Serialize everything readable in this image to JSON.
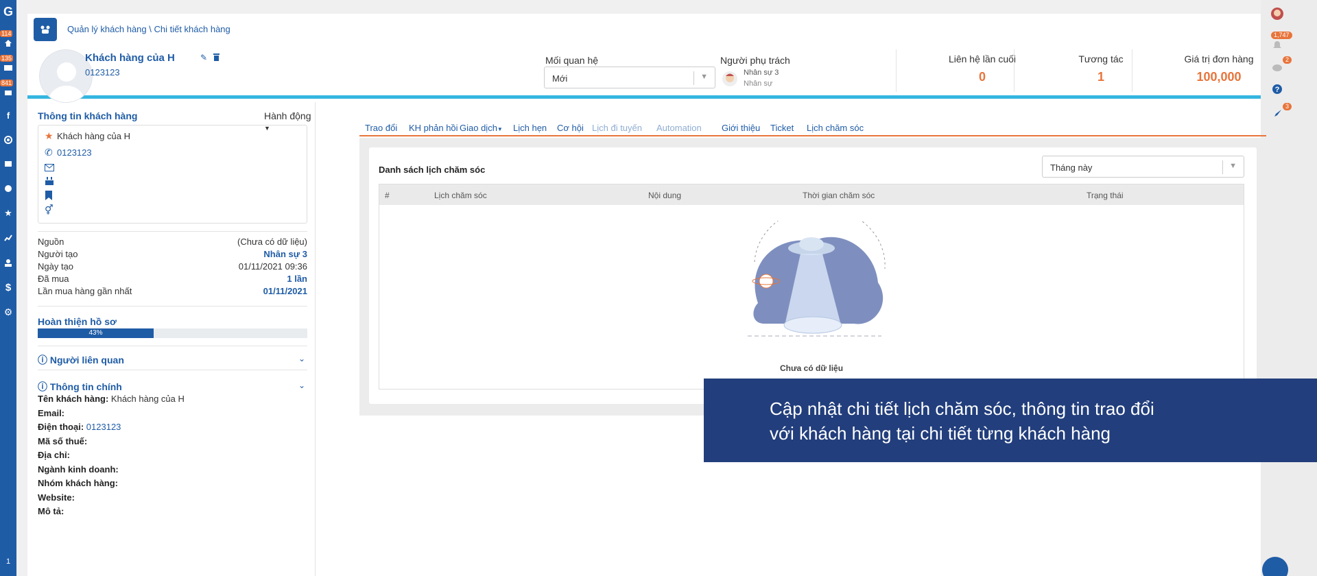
{
  "left_nav": {
    "badges": [
      "114",
      "135",
      "841"
    ],
    "items": [
      "logo-icon",
      "home-icon",
      "mail-icon",
      "cart-icon",
      "facebook-icon",
      "target-icon",
      "shop-icon",
      "coins-icon",
      "star-icon",
      "chart-icon",
      "users-icon",
      "dollar-icon",
      "gear-icon"
    ],
    "bottom_text": "1"
  },
  "right_nav": {
    "badges": [
      "1,747",
      "2",
      "3"
    ],
    "items": [
      "user-avatar-icon",
      "bell-icon",
      "chat-icon",
      "help-icon",
      "rocket-icon"
    ]
  },
  "breadcrumb": "Quản lý khách hàng \\ Chi tiết khách hàng",
  "customer": {
    "name": "Khách hàng của H",
    "phone": "0123123"
  },
  "relationship": {
    "label": "Mối quan hệ",
    "value": "Mới"
  },
  "person_in_charge": {
    "label": "Người phụ trách",
    "name": "Nhân sự 3",
    "role": "Nhân sự"
  },
  "stats": [
    {
      "label": "Liên hệ lần cuối",
      "value": "0"
    },
    {
      "label": "Tương tác",
      "value": "1"
    },
    {
      "label": "Giá trị đơn hàng",
      "value": "100,000"
    }
  ],
  "left_panel": {
    "title": "Thông tin khách hàng",
    "action": "Hành động",
    "infobox": {
      "name": "Khách hàng của H",
      "phone": "0123123"
    },
    "details": [
      {
        "k": "Nguồn",
        "v": "(Chưa có dữ liệu)"
      },
      {
        "k": "Người tạo",
        "v": "Nhân sự 3"
      },
      {
        "k": "Ngày tạo",
        "v": "01/11/2021 09:36"
      },
      {
        "k": "Đã mua",
        "v": "1 lần"
      },
      {
        "k": "Lần mua hàng gần nhất",
        "v": "01/11/2021"
      }
    ],
    "profile_completion": {
      "title": "Hoàn thiện hồ sơ",
      "percent": 43,
      "label": "43%"
    },
    "related": "Người liên quan",
    "main_info": "Thông tin chính",
    "fields": [
      {
        "k": "Tên khách hàng:",
        "v": "Khách hàng của H"
      },
      {
        "k": "Email:",
        "v": ""
      },
      {
        "k": "Điện thoại:",
        "v": "0123123"
      },
      {
        "k": "Mã số thuế:",
        "v": ""
      },
      {
        "k": "Địa chỉ:",
        "v": ""
      },
      {
        "k": "Ngành kinh doanh:",
        "v": ""
      },
      {
        "k": "Nhóm khách hàng:",
        "v": ""
      },
      {
        "k": "Website:",
        "v": ""
      },
      {
        "k": "Mô tả:",
        "v": ""
      }
    ]
  },
  "tabs": [
    "Trao đổi",
    "KH phản hồi",
    "Giao dịch",
    "Lịch hẹn",
    "Cơ hội",
    "Lịch đi tuyến",
    "Automation",
    "Giới thiệu",
    "Ticket",
    "Lịch chăm sóc"
  ],
  "active_tab": "Lịch chăm sóc",
  "care_list": {
    "title": "Danh sách lịch chăm sóc",
    "filter": "Tháng này",
    "columns": [
      "#",
      "Lịch chăm sóc",
      "Nội dung",
      "Thời gian chăm sóc",
      "Trạng thái"
    ],
    "empty": "Chưa có dữ liệu"
  },
  "banner": {
    "line1": "Cập nhật chi tiết lịch chăm sóc, thông tin trao đổi",
    "line2": "với khách hàng tại chi tiết từng khách hàng"
  }
}
